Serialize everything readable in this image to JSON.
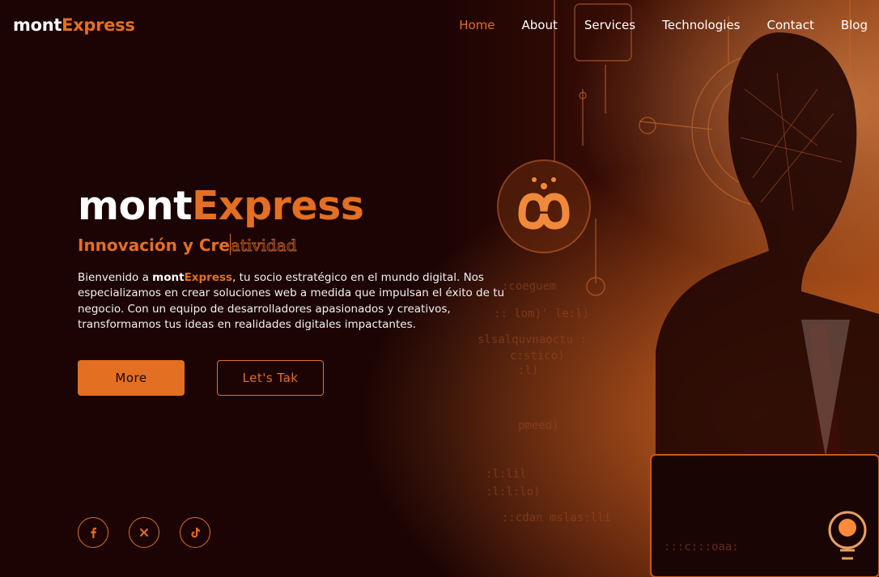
{
  "brand": {
    "part1": "mont",
    "part2": "Express"
  },
  "nav": [
    {
      "label": "Home",
      "active": true
    },
    {
      "label": "About"
    },
    {
      "label": "Services"
    },
    {
      "label": "Technologies"
    },
    {
      "label": "Contact"
    },
    {
      "label": "Blog"
    }
  ],
  "hero": {
    "title_part1": "mont",
    "title_part2": "Express",
    "tagline_typed": "Innovación y Cre",
    "tagline_rest": "atividad",
    "intro_before": "Bienvenido a ",
    "intro_brand1": "mont",
    "intro_brand2": "Express",
    "intro_after": ", tu socio estratégico en el mundo digital. Nos especializamos en crear soluciones web a medida que impulsan el éxito de tu negocio. Con un equipo de desarrolladores apasionados y creativos, transformamos tus ideas en realidades digitales impactantes.",
    "more_label": "More",
    "talk_label": "Let's Tak"
  },
  "social": {
    "facebook": "facebook-icon",
    "x": "x-icon",
    "tiktok": "tiktok-icon"
  },
  "colors": {
    "accent": "#e36f22",
    "background": "#1c0404"
  }
}
